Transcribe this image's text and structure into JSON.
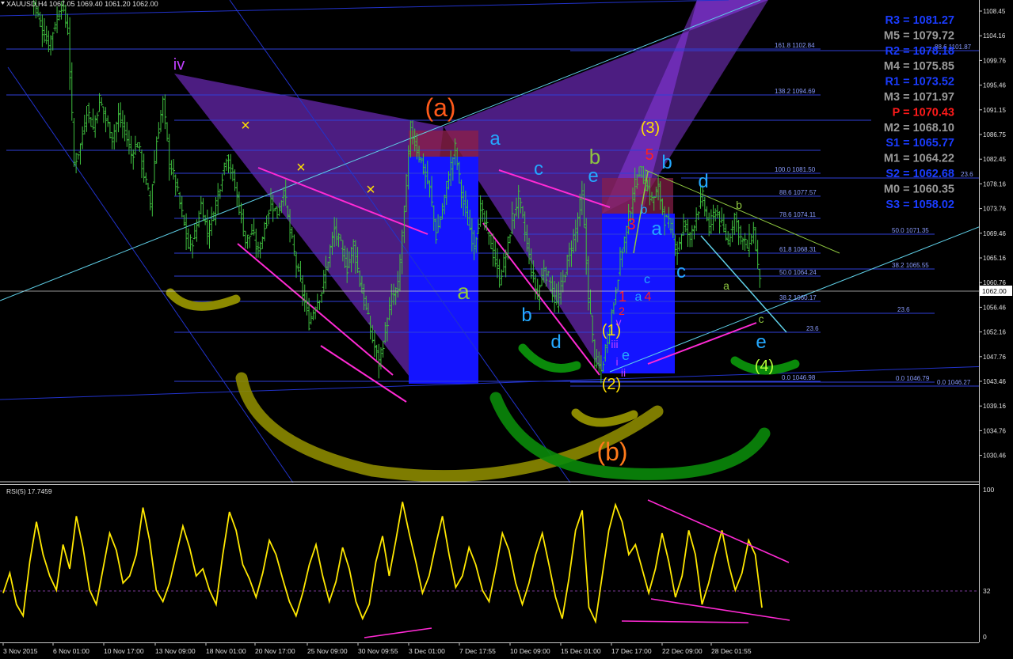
{
  "window": {
    "symbol_header": "XAUUSD,H4  1067.05 1069.40 1061.20 1062.00"
  },
  "price_axis": {
    "ticks": [
      "1108.45",
      "1104.16",
      "1099.76",
      "1095.46",
      "1091.15",
      "1086.75",
      "1082.45",
      "1078.16",
      "1073.76",
      "1069.46",
      "1065.16",
      "1060.76",
      "1056.46",
      "1052.16",
      "1047.76",
      "1043.46",
      "1039.16",
      "1034.76",
      "1030.46"
    ],
    "current_price": "1062.00"
  },
  "time_axis": {
    "ticks": [
      "3 Nov 2015",
      "6 Nov 01:00",
      "10 Nov 17:00",
      "13 Nov 09:00",
      "18 Nov 01:00",
      "20 Nov 17:00",
      "25 Nov 09:00",
      "30 Nov 09:55",
      "3 Dec 01:00",
      "7 Dec 17:55",
      "10 Dec 09:00",
      "15 Dec 01:00",
      "17 Dec 17:00",
      "22 Dec 09:00",
      "28 Dec 01:55"
    ]
  },
  "pivots": [
    {
      "label": "R3 = 1081.27",
      "color": "#1a3cff"
    },
    {
      "label": "M5 = 1079.72",
      "color": "#9a9a9a"
    },
    {
      "label": "R2 = 1078.18",
      "color": "#1a3cff"
    },
    {
      "label": "M4 = 1075.85",
      "color": "#9a9a9a"
    },
    {
      "label": "R1 = 1073.52",
      "color": "#1a3cff"
    },
    {
      "label": "M3 = 1071.97",
      "color": "#9a9a9a"
    },
    {
      "label": "P = 1070.43",
      "color": "#ff1a1a"
    },
    {
      "label": "M2 = 1068.10",
      "color": "#9a9a9a"
    },
    {
      "label": "S1 = 1065.77",
      "color": "#1a3cff"
    },
    {
      "label": "M1 = 1064.22",
      "color": "#9a9a9a"
    },
    {
      "label": "S2 = 1062.68",
      "color": "#1a3cff"
    },
    {
      "label": "M0 = 1060.35",
      "color": "#9a9a9a"
    },
    {
      "label": "S3 = 1058.02",
      "color": "#1a3cff"
    }
  ],
  "fib_levels": [
    {
      "label": "161.8 1102.84"
    },
    {
      "label": "138.2 1094.69"
    },
    {
      "label": "100.0 1081.50"
    },
    {
      "label": "88.6 1077.57"
    },
    {
      "label": "78.6 1074.11"
    },
    {
      "label": "61.8 1068.31"
    },
    {
      "label": "50.0 1064.24"
    },
    {
      "label": "38.2 1060.17"
    },
    {
      "label": "23.6"
    },
    {
      "label": "0.0 1046.98"
    },
    {
      "label": "50.0 1071.35"
    },
    {
      "label": "38.2 1065.55"
    },
    {
      "label": "23.6"
    },
    {
      "label": "0.0 1046.79"
    },
    {
      "label": "0.0 1046.27"
    },
    {
      "label": "23.6"
    },
    {
      "label": "88.6 1101.87"
    }
  ],
  "wave_labels": [
    {
      "text": "(a)",
      "color": "#ff5a1a"
    },
    {
      "text": "(b)",
      "color": "#ff7a1a"
    },
    {
      "text": "(3)",
      "color": "#ffe000"
    },
    {
      "text": "(1)",
      "color": "#ffe000"
    },
    {
      "text": "(2)",
      "color": "#ffe000"
    },
    {
      "text": "(4)",
      "color": "#b8ff3a"
    },
    {
      "text": "a",
      "color": "#24a8ff"
    },
    {
      "text": "a",
      "color": "#8ec63f"
    },
    {
      "text": "b",
      "color": "#24a8ff"
    },
    {
      "text": "c",
      "color": "#24a8ff"
    },
    {
      "text": "d",
      "color": "#24a8ff"
    },
    {
      "text": "e",
      "color": "#24a8ff"
    },
    {
      "text": "b",
      "color": "#8ec63f"
    },
    {
      "text": "e",
      "color": "#24a8ff"
    },
    {
      "text": "5",
      "color": "#ff2020"
    },
    {
      "text": "b",
      "color": "#24a8ff"
    },
    {
      "text": "d",
      "color": "#24a8ff"
    },
    {
      "text": "b",
      "color": "#8ec63f"
    },
    {
      "text": "3",
      "color": "#ff2020"
    },
    {
      "text": "b",
      "color": "#24a8ff"
    },
    {
      "text": "a",
      "color": "#24a8ff"
    },
    {
      "text": "c",
      "color": "#24a8ff"
    },
    {
      "text": "c",
      "color": "#24a8ff"
    },
    {
      "text": "a",
      "color": "#8ec63f"
    },
    {
      "text": "1",
      "color": "#ff2020"
    },
    {
      "text": "a",
      "color": "#24a8ff"
    },
    {
      "text": "4",
      "color": "#ff2020"
    },
    {
      "text": "c",
      "color": "#8ec63f"
    },
    {
      "text": "e",
      "color": "#24a8ff"
    },
    {
      "text": "2",
      "color": "#ff2020"
    },
    {
      "text": "v",
      "color": "#c040ff"
    },
    {
      "text": "iii",
      "color": "#c040ff"
    },
    {
      "text": "i",
      "color": "#c040ff"
    },
    {
      "text": "ii",
      "color": "#c040ff"
    },
    {
      "text": "iv",
      "color": "#c040ff"
    },
    {
      "text": "×",
      "color": "#ffe000"
    },
    {
      "text": "×",
      "color": "#ffe000"
    },
    {
      "text": "×",
      "color": "#ffe000"
    },
    {
      "text": "×",
      "color": "#ffe000"
    }
  ],
  "rsi_panel": {
    "title": "RSI(5) 17.7459",
    "levels": [
      "100",
      "32",
      "0"
    ]
  },
  "chart_data": {
    "type": "line",
    "title": "XAUUSD,H4  1067.05 1069.40 1061.20 1062.00",
    "price_series": {
      "name": "XAUUSD H4",
      "values": [
        1113.0,
        1109.5,
        1106.0,
        1103.5,
        1107.0,
        1110.5,
        1106.0,
        1083.0,
        1086.0,
        1092.5,
        1089.0,
        1094.0,
        1090.5,
        1087.5,
        1091.0,
        1088.5,
        1084.5,
        1086.5,
        1081.0,
        1076.0,
        1087.0,
        1093.5,
        1083.0,
        1079.5,
        1074.0,
        1068.5,
        1070.5,
        1076.0,
        1071.0,
        1074.5,
        1079.5,
        1084.5,
        1080.5,
        1075.5,
        1069.5,
        1071.0,
        1067.5,
        1072.0,
        1076.5,
        1074.0,
        1078.5,
        1071.0,
        1065.5,
        1060.5,
        1055.5,
        1058.5,
        1061.0,
        1066.5,
        1071.5,
        1068.5,
        1065.0,
        1069.0,
        1062.5,
        1057.5,
        1052.5,
        1048.5,
        1054.0,
        1059.5,
        1061.5,
        1075.0,
        1089.0,
        1085.5,
        1082.0,
        1078.5,
        1070.5,
        1075.0,
        1081.0,
        1085.5,
        1077.5,
        1073.0,
        1069.0,
        1075.0,
        1071.5,
        1067.5,
        1063.0,
        1067.0,
        1073.5,
        1077.0,
        1071.0,
        1064.5,
        1060.0,
        1065.0,
        1062.0,
        1058.5,
        1063.0,
        1067.5,
        1071.5,
        1077.5,
        1060.0,
        1049.0,
        1047.0,
        1053.0,
        1059.0,
        1066.5,
        1071.5,
        1077.5,
        1082.0,
        1079.5,
        1076.5,
        1078.5,
        1073.5,
        1071.5,
        1068.0,
        1072.5,
        1070.0,
        1074.5,
        1077.0,
        1071.5,
        1075.0,
        1072.0,
        1069.5,
        1074.0,
        1070.0,
        1068.5,
        1071.5,
        1062.0
      ]
    },
    "rsi_series": {
      "name": "RSI(5) 17.7459",
      "values": [
        28,
        42,
        20,
        12,
        50,
        78,
        55,
        40,
        30,
        62,
        45,
        82,
        60,
        30,
        20,
        45,
        70,
        58,
        35,
        40,
        55,
        88,
        65,
        30,
        22,
        35,
        55,
        75,
        60,
        40,
        45,
        30,
        20,
        55,
        85,
        72,
        48,
        38,
        25,
        42,
        65,
        55,
        38,
        22,
        12,
        28,
        48,
        62,
        40,
        22,
        36,
        60,
        45,
        22,
        10,
        20,
        50,
        68,
        40,
        65,
        92,
        70,
        50,
        28,
        40,
        62,
        82,
        55,
        32,
        40,
        60,
        48,
        30,
        22,
        45,
        70,
        58,
        35,
        20,
        35,
        55,
        70,
        48,
        25,
        10,
        38,
        72,
        86,
        18,
        8,
        40,
        72,
        90,
        78,
        55,
        62,
        45,
        28,
        45,
        70,
        50,
        25,
        40,
        72,
        55,
        20,
        35,
        55,
        72,
        48,
        30,
        42,
        65,
        55,
        17.7
      ]
    },
    "y_range_price": [
      1028.5,
      1110.5
    ],
    "y_range_rsi": [
      0,
      100
    ],
    "grid": false
  }
}
